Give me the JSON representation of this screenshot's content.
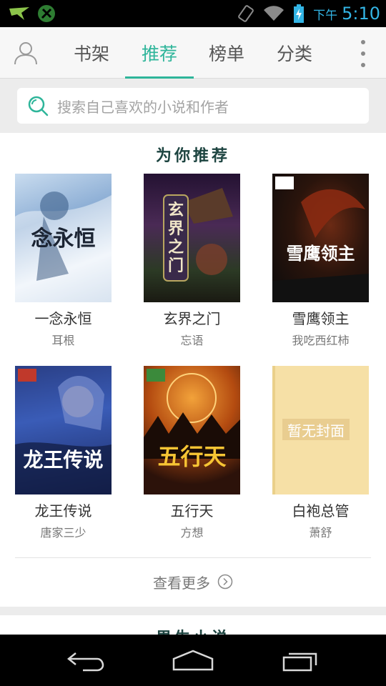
{
  "status_bar": {
    "ampm": "下午",
    "time": "5:10",
    "icons": [
      "notification-bird-icon",
      "tools-icon",
      "rotate-lock-icon",
      "wifi-icon",
      "battery-charging-icon"
    ]
  },
  "tabs": [
    {
      "label": "书架",
      "active": false
    },
    {
      "label": "推荐",
      "active": true
    },
    {
      "label": "榜单",
      "active": false
    },
    {
      "label": "分类",
      "active": false
    }
  ],
  "search": {
    "placeholder": "搜索自己喜欢的小说和作者"
  },
  "recommend": {
    "title": "为你推荐",
    "books": [
      {
        "title": "一念永恒",
        "author": "耳根",
        "cover_text": "念永恒"
      },
      {
        "title": "玄界之门",
        "author": "忘语",
        "cover_text": "玄界之门"
      },
      {
        "title": "雪鹰领主",
        "author": "我吃西红柿",
        "cover_text": "雪鹰领主"
      },
      {
        "title": "龙王传说",
        "author": "唐家三少",
        "cover_text": "龙王传说"
      },
      {
        "title": "五行天",
        "author": "方想",
        "cover_text": "五行天"
      },
      {
        "title": "白袍总管",
        "author": "萧舒",
        "cover_text": "暂无封面"
      }
    ],
    "more_label": "查看更多"
  },
  "next_section": {
    "title": "男生小说"
  },
  "colors": {
    "accent": "#2eb59a",
    "status_blue": "#33b5e5",
    "title_dark": "#1d4440"
  }
}
